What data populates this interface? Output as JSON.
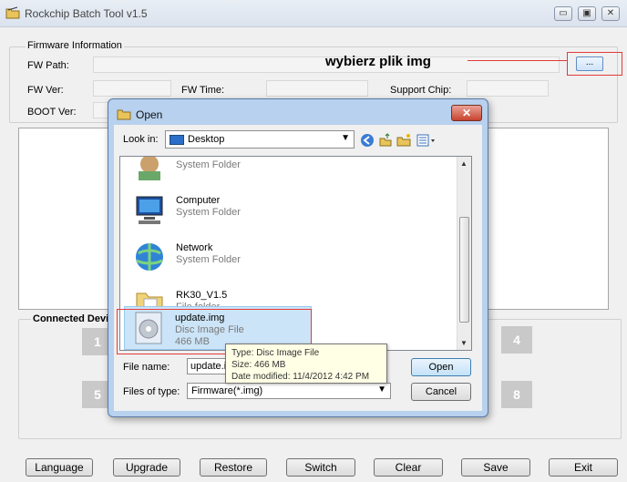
{
  "app": {
    "title": "Rockchip Batch Tool v1.5",
    "window_buttons": {
      "minimize": "▭",
      "maximize": "▣",
      "close": "✕"
    }
  },
  "firmware": {
    "group_title": "Firmware Information",
    "fw_path_label": "FW Path:",
    "fw_ver_label": "FW Ver:",
    "fw_time_label": "FW Time:",
    "support_chip_label": "Support Chip:",
    "boot_ver_label": "BOOT Ver:",
    "browse_label": "...",
    "annotation": "wybierz plik img"
  },
  "devices": {
    "group_title": "Connected Devic",
    "slots": [
      "1",
      "4",
      "5",
      "8"
    ]
  },
  "buttons": {
    "language": "Language",
    "upgrade": "Upgrade",
    "restore": "Restore",
    "switch": "Switch",
    "clear": "Clear",
    "save": "Save",
    "exit": "Exit"
  },
  "dialog": {
    "title": "Open",
    "close": "✕",
    "look_in_label": "Look in:",
    "look_in_value": "Desktop",
    "items": [
      {
        "name": "",
        "type": "System Folder",
        "size": "",
        "icon": "user-folder-icon"
      },
      {
        "name": "Computer",
        "type": "System Folder",
        "size": "",
        "icon": "computer-icon"
      },
      {
        "name": "Network",
        "type": "System Folder",
        "size": "",
        "icon": "network-icon"
      },
      {
        "name": "RK30_V1.5",
        "type": "File folder",
        "size": "",
        "icon": "folder-icon"
      },
      {
        "name": "update.img",
        "type": "Disc Image File",
        "size": "466 MB",
        "icon": "disc-image-icon"
      }
    ],
    "tooltip": {
      "type": "Type: Disc Image File",
      "size": "Size: 466 MB",
      "modified": "Date modified: 11/4/2012 4:42 PM"
    },
    "file_name_label": "File name:",
    "file_name_value": "update.im",
    "files_of_type_label": "Files of type:",
    "files_of_type_value": "Firmware(*.img)",
    "open_label": "Open",
    "cancel_label": "Cancel"
  },
  "colors": {
    "annotation_red": "#e43a3a",
    "selection_blue": "#cce4f7",
    "dialog_frame": "#b7d1ee"
  }
}
